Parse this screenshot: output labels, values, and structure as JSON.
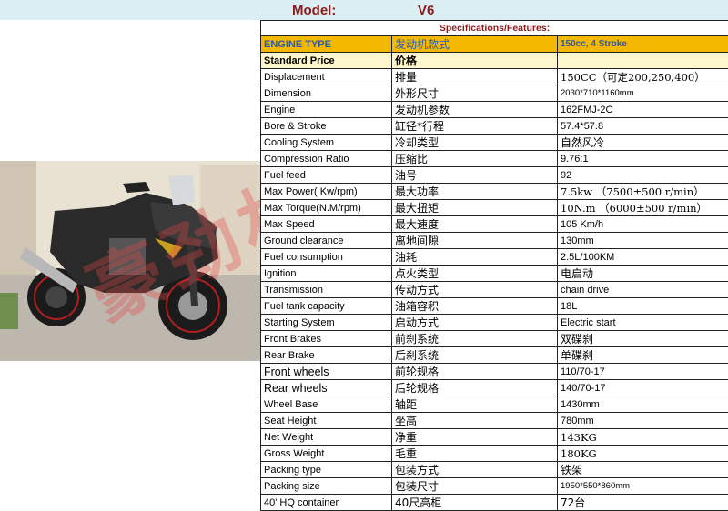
{
  "header": {
    "model_label": "Model:",
    "model_value": "V6"
  },
  "specs_title": "Specifications/Features:",
  "engine_type": {
    "label": "ENGINE TYPE",
    "cn": "发动机款式",
    "value": "150cc, 4 Stroke"
  },
  "standard_price": {
    "label": "Standard Price",
    "cn": "价格",
    "value": ""
  },
  "rows": [
    {
      "label": "Displacement",
      "cn": "排量",
      "value": "150CC（可定200,250,400）"
    },
    {
      "label": "Dimension",
      "cn": "外形尺寸",
      "value": "2030*710*1160mm"
    },
    {
      "label": "Engine",
      "cn": "发动机参数",
      "value": "162FMJ-2C"
    },
    {
      "label": "Bore & Stroke",
      "cn": "缸径*行程",
      "value": "57.4*57.8"
    },
    {
      "label": "Cooling System",
      "cn": "冷却类型",
      "value": "自然风冷"
    },
    {
      "label": "Compression Ratio",
      "cn": "压缩比",
      "value": "9.76:1"
    },
    {
      "label": "Fuel feed",
      "cn": "油号",
      "value": "92"
    },
    {
      "label": "Max Power( Kw/rpm)",
      "cn": "最大功率",
      "value": "7.5kw （7500±500 r/min）"
    },
    {
      "label": "Max Torque(N.M/rpm)",
      "cn": "最大扭矩",
      "value": "10N.m （6000±500 r/min）"
    },
    {
      "label": "Max Speed",
      "cn": "最大速度",
      "value": "105 Km/h"
    },
    {
      "label": "Ground clearance",
      "cn": "离地间隙",
      "value": "130mm"
    },
    {
      "label": "Fuel consumption",
      "cn": "油耗",
      "value": "2.5L/100KM"
    },
    {
      "label": "Ignition",
      "cn": "点火类型",
      "value": "电启动"
    },
    {
      "label": "Transmission",
      "cn": "传动方式",
      "value": "chain drive"
    },
    {
      "label": "Fuel tank capacity",
      "cn": "油箱容积",
      "value": "18L"
    },
    {
      "label": "Starting System",
      "cn": "启动方式",
      "value": "Electric start"
    },
    {
      "label": "Front Brakes",
      "cn": "前刹系统",
      "value": "双碟刹"
    },
    {
      "label": "Rear Brake",
      "cn": "后刹系统",
      "value": "单碟刹"
    },
    {
      "label": "Front wheels",
      "cn": "前轮规格",
      "value": "110/70-17"
    },
    {
      "label": "Rear wheels",
      "cn": "后轮规格",
      "value": "140/70-17"
    },
    {
      "label": "Wheel Base",
      "cn": "轴距",
      "value": "1430mm"
    },
    {
      "label": "Seat Height",
      "cn": "坐高",
      "value": "780mm"
    },
    {
      "label": "Net Weight",
      "cn": "净重",
      "value": "143KG"
    },
    {
      "label": "Gross Weight",
      "cn": "毛重",
      "value": "180KG"
    },
    {
      "label": "Packing type",
      "cn": "包装方式",
      "value": "铁架"
    },
    {
      "label": "Packing size",
      "cn": "包装尺寸",
      "value": "1950*550*860mm"
    },
    {
      "label": "40' HQ container",
      "cn": "40尺高柜",
      "value": "72台"
    }
  ],
  "watermark": "豪劲机车",
  "colors": {
    "header_bg": "#daeef3",
    "title_red": "#8b1a1a",
    "engine_bg": "#f5b800",
    "engine_text": "#2a5aa8",
    "price_bg": "#fff8cc"
  }
}
